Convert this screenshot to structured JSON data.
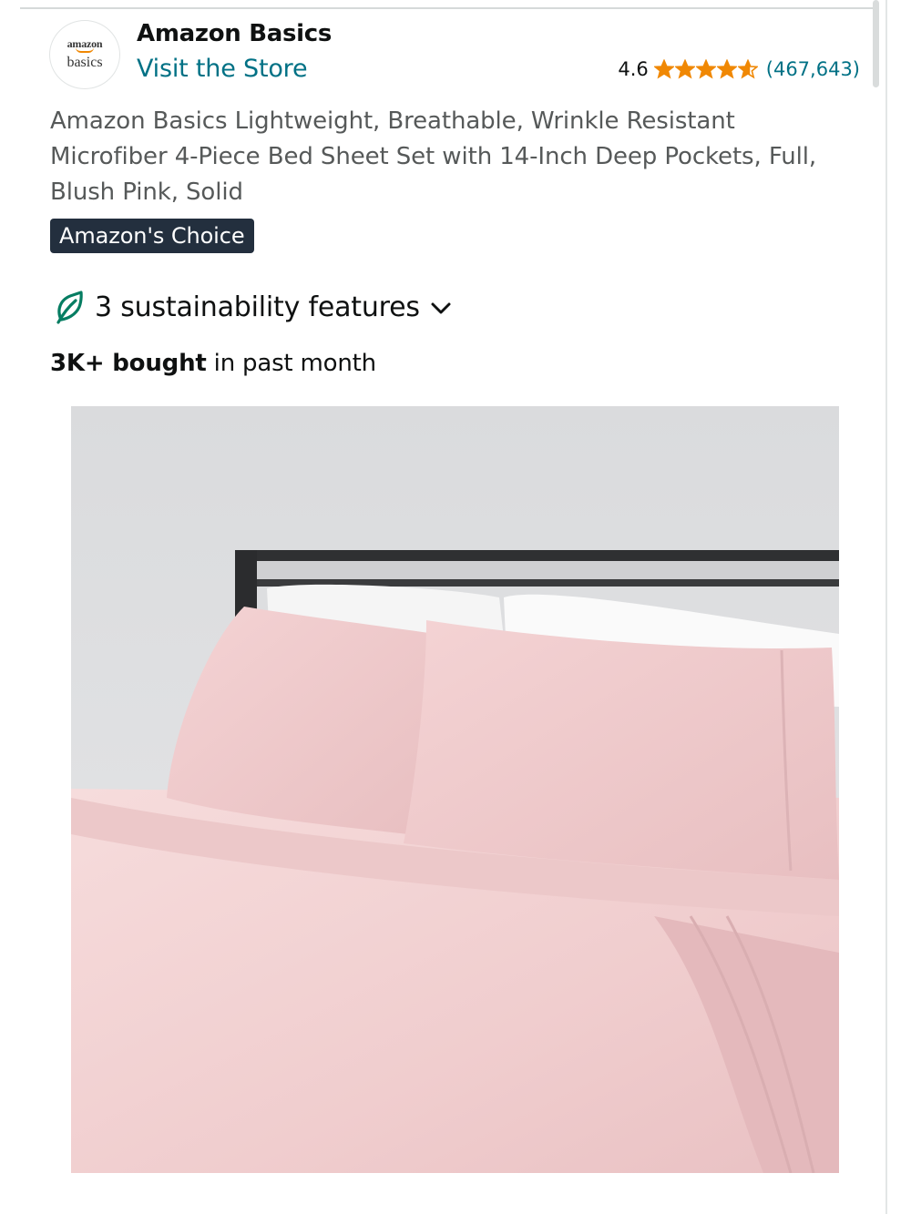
{
  "store": {
    "logo_line1": "amazon",
    "logo_line2": "basics",
    "brand_name": "Amazon Basics",
    "visit_link": "Visit the Store"
  },
  "rating": {
    "value": "4.6",
    "stars_value": 4.6,
    "stars_max": 5,
    "count": "(467,643)"
  },
  "product": {
    "title": "Amazon Basics Lightweight, Breathable, Wrinkle Resistant Microfiber 4-Piece Bed Sheet Set with 14-Inch Deep Pockets, Full, Blush Pink, Solid",
    "badge": "Amazon's Choice",
    "sustainability": "3 sustainability features",
    "bought_strong": "3K+ bought",
    "bought_rest": " in past month",
    "image_icon": "bed-sheet-product-photo"
  },
  "colors": {
    "link": "#007185",
    "star": "#f08804",
    "badge_bg": "#232f3e",
    "leaf": "#067d62",
    "sheet_pink": "#f2cfd0"
  }
}
